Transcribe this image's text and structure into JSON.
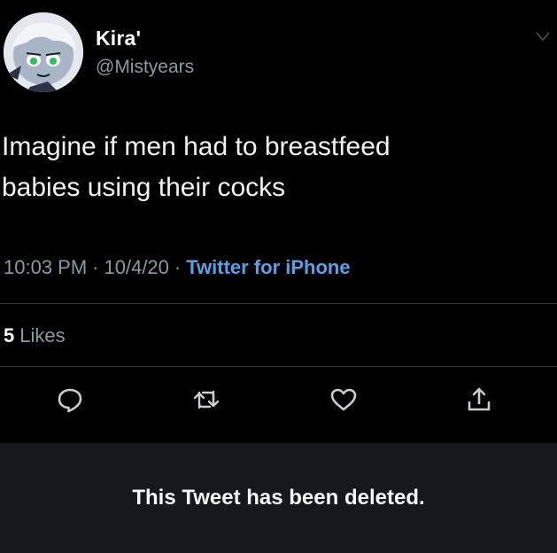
{
  "tweet": {
    "display_name": "Kira'",
    "handle": "@Mistyears",
    "text_line1": "Imagine if men had to breastfeed",
    "text_line2": "babies using their cocks",
    "time": "10:03 PM",
    "date": "10/4/20",
    "source": "Twitter for iPhone",
    "separator": "·",
    "likes_count": "5",
    "likes_label": "Likes"
  },
  "actions": {
    "reply_icon": "reply-icon",
    "retweet_icon": "retweet-icon",
    "like_icon": "heart-icon",
    "share_icon": "share-icon"
  },
  "deleted_banner": {
    "text": "This Tweet has been deleted."
  },
  "colors": {
    "background": "#000000",
    "secondary_text": "#8b98a5",
    "link": "#5aa0e6",
    "divider": "#2f3336",
    "banner_background": "#15181c"
  }
}
